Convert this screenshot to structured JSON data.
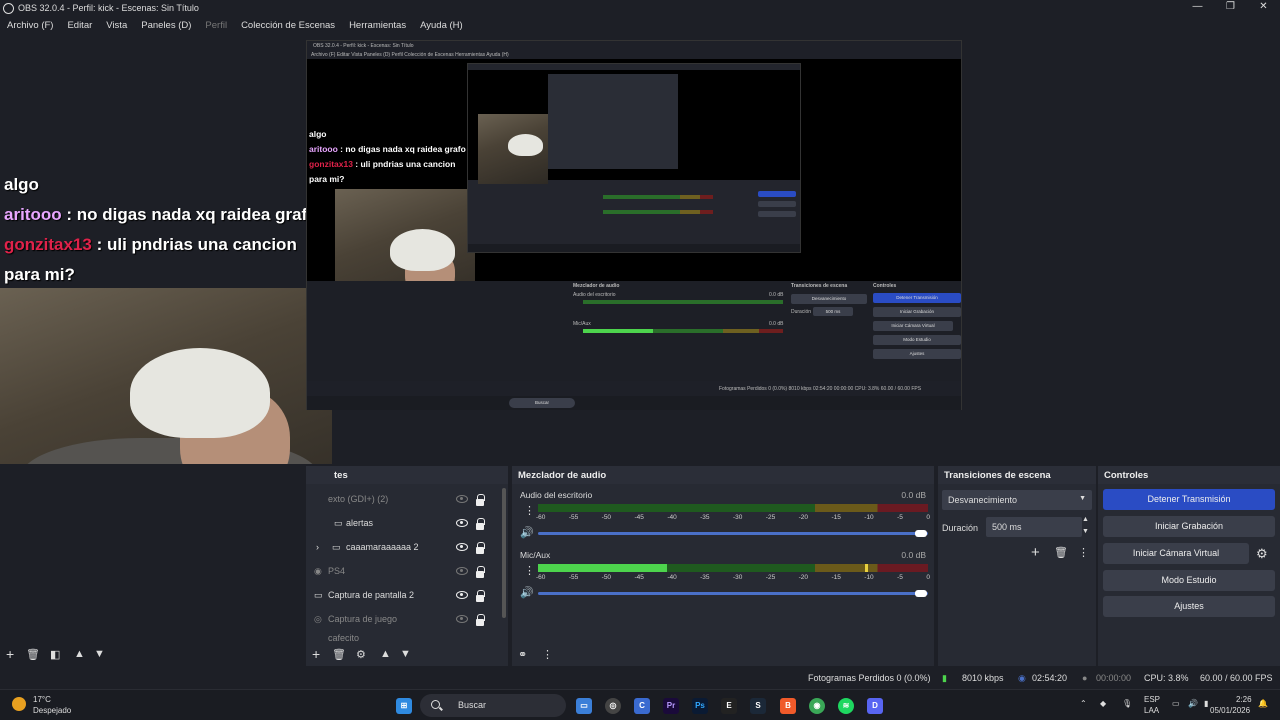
{
  "window": {
    "title": "OBS 32.0.4 - Perfil: kick - Escenas: Sin Título",
    "controls": [
      "—",
      "❐",
      "✕"
    ]
  },
  "menu": [
    "Archivo (F)",
    "Editar",
    "Vista",
    "Paneles (D)",
    "Perfil",
    "Colección de Escenas",
    "Herramientas",
    "Ayuda (H)"
  ],
  "preview": {
    "chat": {
      "line1": "algo",
      "user1": "aritooo",
      "msg1": " : no digas nada xq raidea grafo",
      "user2": "gonzitax13",
      "msg2": " : uli pndrias una cancion",
      "msg2b": "para mi?"
    },
    "nested_obs": {
      "title": "OBS 32.0.4 - Perfil: kick - Escenas: Sin Título",
      "menu": "Archivo (F)   Editar   Vista   Paneles (D)   Perfil   Colección de Escenas   Herramientas   Ayuda (H)",
      "mixer": "Mezclador de audio",
      "transitions": "Transiciones de escena",
      "controls": "Controles",
      "btn_stream": "Detener Transmisión",
      "btn_rec": "Iniciar Grabación",
      "btn_vcam": "Iniciar Cámara Virtual",
      "btn_studio": "Modo Estudio",
      "btn_settings": "Ajustes",
      "fade": "Desvanecimiento",
      "duration": "Duración",
      "duration_val": "500 ms",
      "desktop_audio": "Audio del escritorio",
      "mic": "Mic/Aux",
      "zero_db": "0.0 dB",
      "status": "Fotogramas Perdidos 0 (0.0%)     8010 kbps     02:54:20     00:00:00     CPU: 3.8%     60.00 / 60.00 FPS",
      "search": "Buscar"
    }
  },
  "sources": {
    "header": "tes",
    "items": [
      {
        "label": "exto (GDI+) (2)",
        "visible": false
      },
      {
        "label": "alertas",
        "visible": true
      },
      {
        "label": "caaamaraaaaaa 2",
        "visible": true
      },
      {
        "label": "PS4",
        "visible": false
      },
      {
        "label": "Captura de pantalla 2",
        "visible": true
      },
      {
        "label": "Captura de juego",
        "visible": false
      },
      {
        "label": "cafecito",
        "visible": false
      }
    ]
  },
  "mixer": {
    "header": "Mezclador de audio",
    "channels": [
      {
        "name": "Audio del escritorio",
        "db": "0.0 dB",
        "level": 0.0,
        "volume": 1.0
      },
      {
        "name": "Mic/Aux",
        "db": "0.0 dB",
        "level": 0.33,
        "volume": 1.0
      }
    ],
    "ticks": [
      "-60",
      "-55",
      "-50",
      "-45",
      "-40",
      "-35",
      "-30",
      "-25",
      "-20",
      "-15",
      "-10",
      "-5",
      "0"
    ]
  },
  "transitions": {
    "header": "Transiciones de escena",
    "selected": "Desvanecimiento",
    "duration_label": "Duración",
    "duration_value": "500 ms"
  },
  "controls": {
    "header": "Controles",
    "stream": "Detener Transmisión",
    "record": "Iniciar Grabación",
    "vcam": "Iniciar Cámara Virtual",
    "studio": "Modo Estudio",
    "settings": "Ajustes"
  },
  "status": {
    "dropped": "Fotogramas Perdidos 0 (0.0%)",
    "bitrate": "8010 kbps",
    "stream_time": "02:54:20",
    "rec_time": "00:00:00",
    "cpu": "CPU: 3.8%",
    "fps": "60.00 / 60.00 FPS"
  },
  "taskbar": {
    "weather_temp": "17°C",
    "weather_desc": "Despejado",
    "search": "Buscar",
    "lang1": "ESP",
    "lang2": "LAA",
    "time": "2:26",
    "date": "05/01/2026"
  },
  "colors": {
    "accent": "#2a4cc4",
    "chat_user1": "#e8a6ff",
    "chat_user2": "#e0224a",
    "meter_green": "#4dd44d"
  }
}
